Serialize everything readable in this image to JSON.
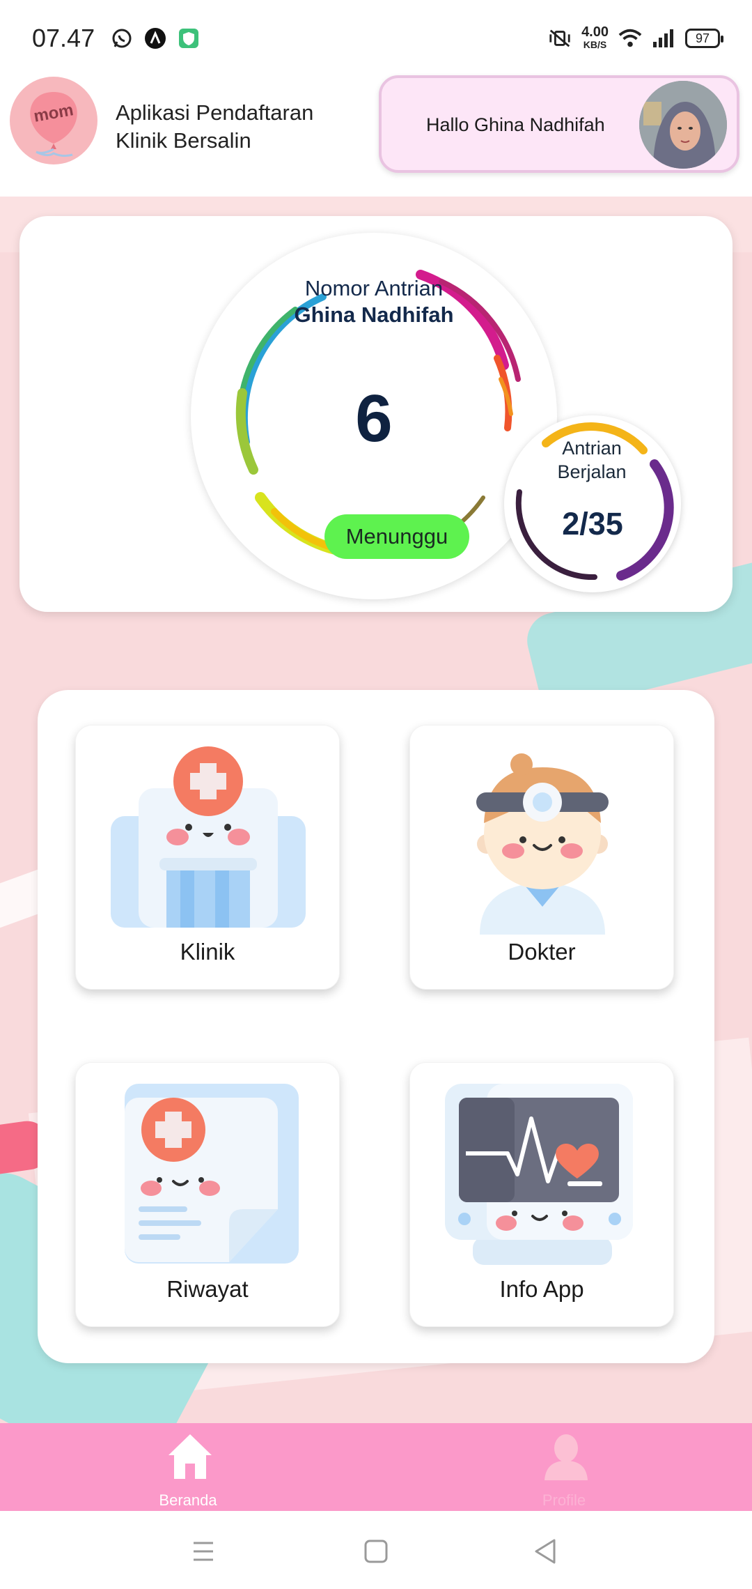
{
  "status_bar": {
    "time": "07.47",
    "icons_left": [
      "whatsapp-icon",
      "app-a-icon",
      "shield-app-icon"
    ],
    "net_speed_value": "4.00",
    "net_speed_unit": "KB/S",
    "battery": "97"
  },
  "header": {
    "logo_text": "mom",
    "app_title": "Aplikasi Pendaftaran Klinik Bersalin",
    "greeting": "Hallo Ghina Nadhifah"
  },
  "queue": {
    "label": "Nomor Antrian",
    "name": "Ghina Nadhifah",
    "number": "6",
    "status": "Menunggu",
    "running_label": "Antrian Berjalan",
    "running_value": "2/35",
    "running_progress": 0.0571
  },
  "menu": {
    "items": [
      {
        "label": "Klinik",
        "icon": "hospital-icon"
      },
      {
        "label": "Dokter",
        "icon": "doctor-icon"
      },
      {
        "label": "Riwayat",
        "icon": "medical-record-icon"
      },
      {
        "label": "Info App",
        "icon": "heart-monitor-icon"
      }
    ]
  },
  "bottom_nav": {
    "items": [
      {
        "label": "Beranda",
        "icon": "home-icon",
        "active": true
      },
      {
        "label": "Profile",
        "icon": "profile-icon",
        "active": false
      }
    ]
  },
  "colors": {
    "accent_pink": "#fb99c9",
    "status_green": "#5ef24f",
    "background_pink": "#f9dadc",
    "teal": "#a9e3e1"
  }
}
